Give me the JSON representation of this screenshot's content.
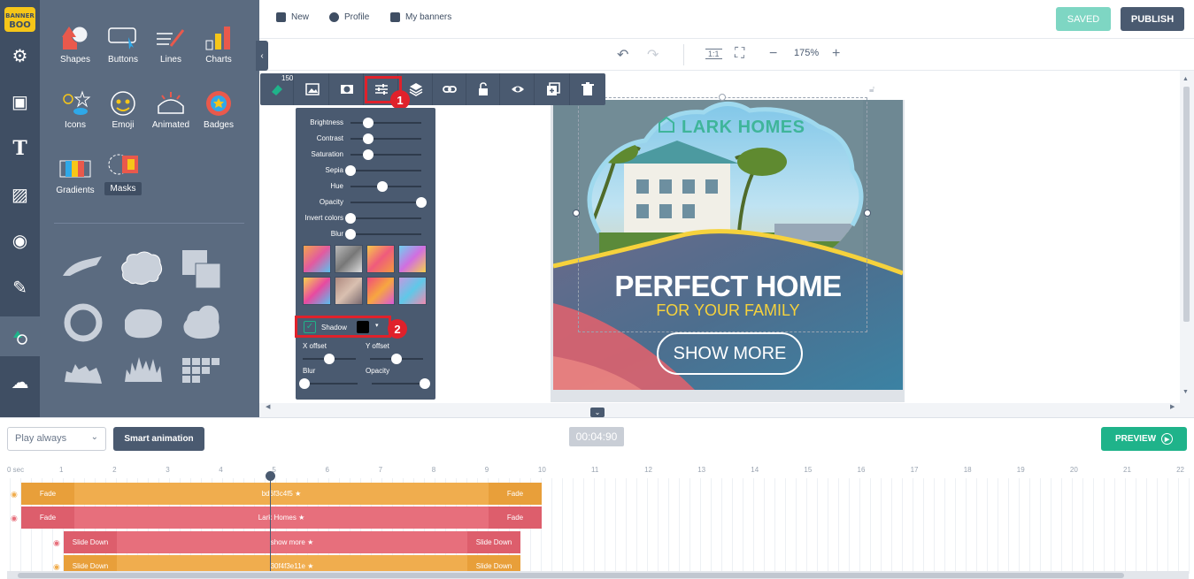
{
  "brand": {
    "logo_text": "BANNER BOO"
  },
  "topbar": {
    "new_label": "New",
    "profile_label": "Profile",
    "mybanners_label": "My banners",
    "saved_label": "SAVED",
    "publish_label": "PUBLISH"
  },
  "subbar": {
    "zoom": "175%",
    "actual_size_label": "1:1"
  },
  "panel": {
    "categories": [
      "Shapes",
      "Buttons",
      "Lines",
      "Charts",
      "Icons",
      "Emoji",
      "Animated",
      "Badges",
      "Gradients",
      "Masks"
    ],
    "selected": "Masks"
  },
  "element_toolbar": {
    "layer_count": "150"
  },
  "filters": {
    "brightness": {
      "label": "Brightness",
      "value": 0.25
    },
    "contrast": {
      "label": "Contrast",
      "value": 0.25
    },
    "saturation": {
      "label": "Saturation",
      "value": 0.25
    },
    "sepia": {
      "label": "Sepia",
      "value": 0.0
    },
    "hue": {
      "label": "Hue",
      "value": 0.45
    },
    "opacity": {
      "label": "Opacity",
      "value": 1.0
    },
    "invert": {
      "label": "Invert colors",
      "value": 0.0
    },
    "blur": {
      "label": "Blur",
      "value": 0.0
    },
    "shadow": {
      "label": "Shadow",
      "checked": true,
      "color": "#000000"
    },
    "x_offset": {
      "label": "X offset",
      "value": 0.5
    },
    "y_offset": {
      "label": "Y offset",
      "value": 0.5
    },
    "shadow_blur": {
      "label": "Blur",
      "value": 0.0
    },
    "shadow_opacity": {
      "label": "Opacity",
      "value": 1.0
    }
  },
  "annotations": {
    "one": "1",
    "two": "2"
  },
  "banner": {
    "brand": "LARK HOMES",
    "headline": "PERFECT HOME",
    "subheadline": "FOR YOUR FAMILY",
    "cta": "SHOW MORE"
  },
  "timeline": {
    "play_mode": "Play always",
    "smart_label": "Smart animation",
    "time": "00:04:90",
    "preview_label": "PREVIEW",
    "ruler_unit": "0 sec",
    "ticks": [
      "1",
      "2",
      "3",
      "4",
      "5",
      "6",
      "7",
      "8",
      "9",
      "10",
      "11",
      "12",
      "13",
      "14",
      "15",
      "16",
      "17",
      "18",
      "19",
      "20",
      "21",
      "22"
    ],
    "tracks": [
      {
        "name": "bd6f3c4f5",
        "in": "Fade",
        "out": "Fade"
      },
      {
        "name": "Lark Homes",
        "in": "Fade",
        "out": "Fade"
      },
      {
        "name": "show more",
        "in": "Slide Down",
        "out": "Slide Down"
      },
      {
        "name": "30f4f3e11e",
        "in": "Slide Down",
        "out": "Slide Down"
      }
    ]
  },
  "colors": {
    "rail": "#3f4e63",
    "panel": "#5b6b80",
    "accent": "#1fb38a",
    "highlight": "#e0212b"
  }
}
